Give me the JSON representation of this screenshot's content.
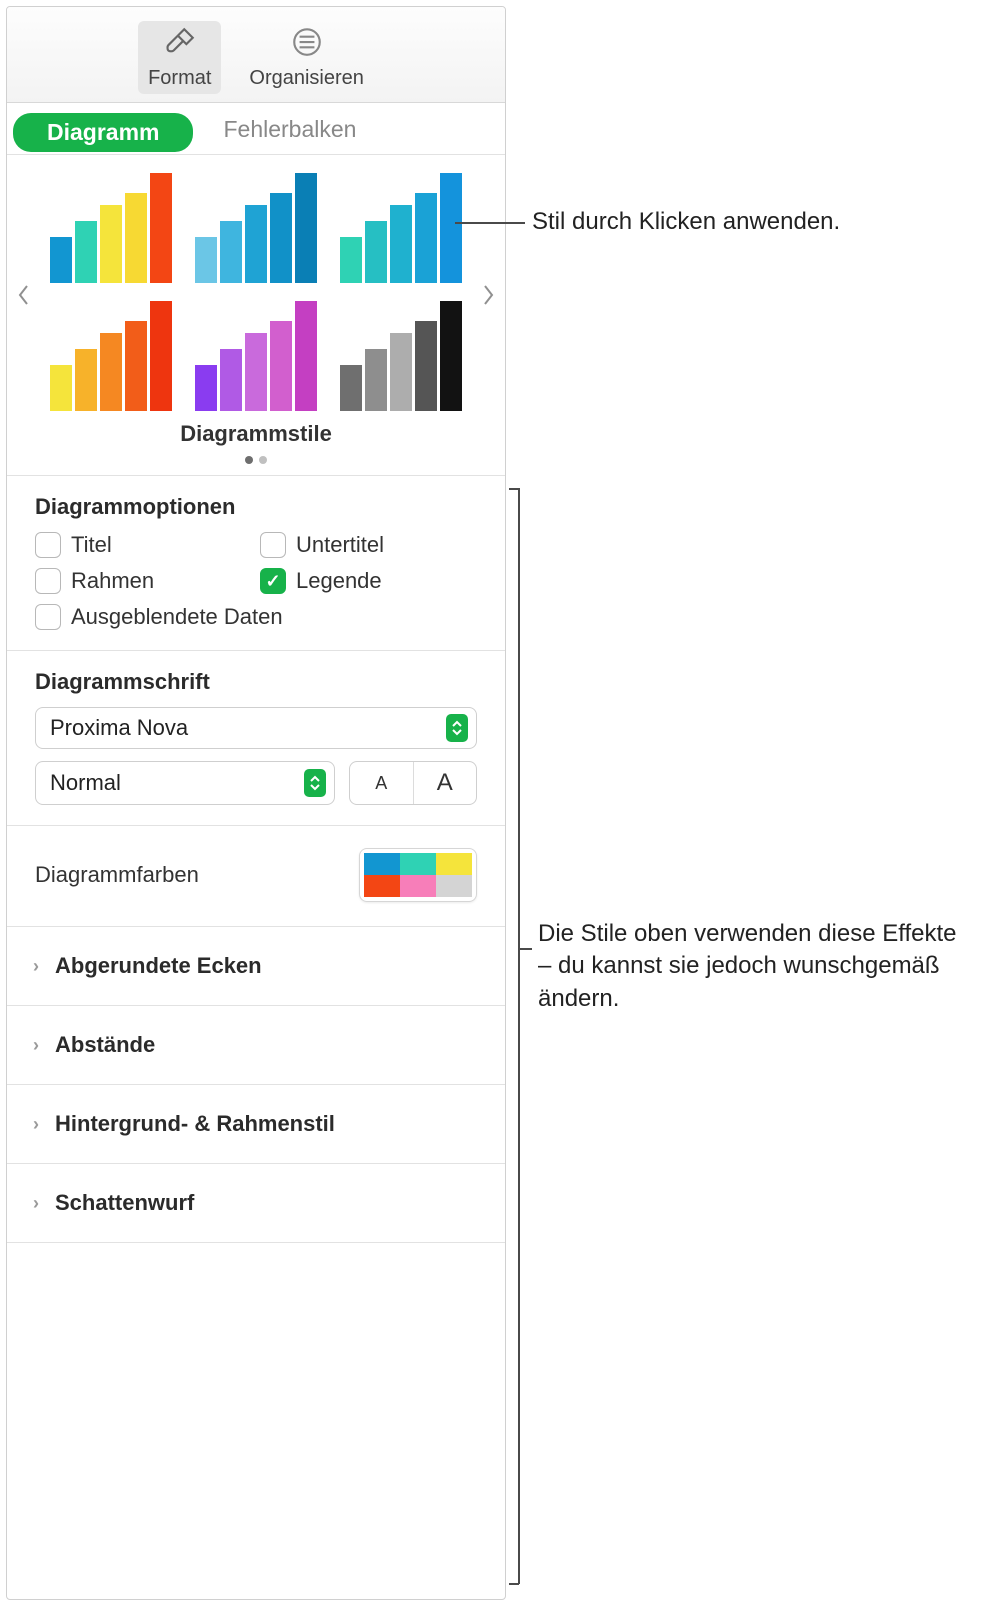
{
  "toolbar": {
    "format_label": "Format",
    "organize_label": "Organisieren"
  },
  "tabs": {
    "chart": "Diagramm",
    "errorbars": "Fehlerbalken"
  },
  "styles": {
    "title": "Diagrammstile",
    "thumbs": [
      {
        "colors": [
          "#1296d1",
          "#2fd2b4",
          "#f5e43b",
          "#f7d933",
          "#f34614"
        ]
      },
      {
        "colors": [
          "#6bc6e6",
          "#3fb5df",
          "#1fa3d4",
          "#1191c8",
          "#0a7fb5"
        ]
      },
      {
        "colors": [
          "#2fd2b4",
          "#26bfc3",
          "#1fb1cf",
          "#1aa2d6",
          "#1493dc"
        ]
      },
      {
        "colors": [
          "#f5e43b",
          "#f7b22a",
          "#f58822",
          "#f25d19",
          "#ee350f"
        ]
      },
      {
        "colors": [
          "#8a3cf0",
          "#b05ae5",
          "#c96adc",
          "#d25fce",
          "#c43fc2"
        ]
      },
      {
        "colors": [
          "#6f6f6f",
          "#8e8e8e",
          "#adadad",
          "#555555",
          "#121212"
        ]
      }
    ]
  },
  "options": {
    "title": "Diagrammoptionen",
    "items": {
      "titel": {
        "label": "Titel",
        "checked": false
      },
      "untertitel": {
        "label": "Untertitel",
        "checked": false
      },
      "rahmen": {
        "label": "Rahmen",
        "checked": false
      },
      "legende": {
        "label": "Legende",
        "checked": true
      },
      "hidden": {
        "label": "Ausgeblendete Daten",
        "checked": false
      }
    }
  },
  "font": {
    "title": "Diagrammschrift",
    "family": "Proxima Nova",
    "style": "Normal"
  },
  "colors": {
    "title": "Diagrammfarben"
  },
  "disclosures": {
    "rounded": "Abgerundete Ecken",
    "gaps": "Abstände",
    "bg": "Hintergrund- & Rahmenstil",
    "shadow": "Schattenwurf"
  },
  "callouts": {
    "apply_style": "Stil durch Klicken anwenden.",
    "effects": "Die Stile oben verwenden diese Effekte – du kannst sie jedoch wunschgemäß ändern."
  }
}
